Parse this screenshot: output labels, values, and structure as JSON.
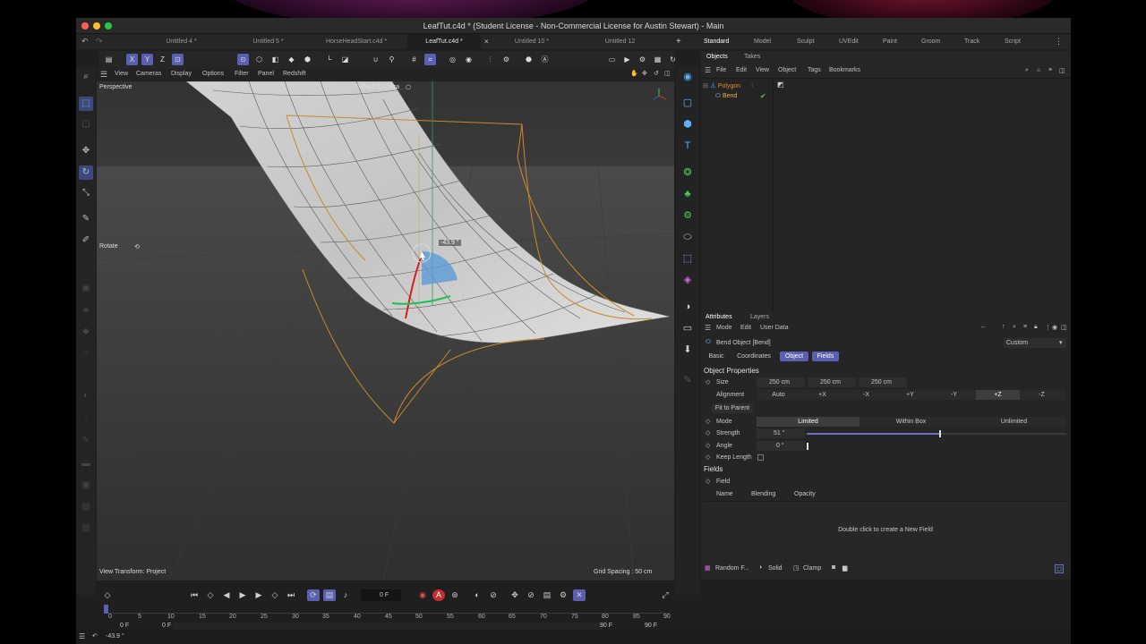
{
  "window": {
    "title": "LeafTut.c4d * (Student License - Non-Commercial License for Austin Stewart) - Main"
  },
  "doc_tabs": [
    {
      "label": "Untitled 4 *"
    },
    {
      "label": "Untitled 5 *"
    },
    {
      "label": "HorseHeadStart.c4d *"
    },
    {
      "label": "LeafTut.c4d *",
      "active": true
    },
    {
      "label": "Untitled 10 *"
    },
    {
      "label": "Untitled 12"
    }
  ],
  "new_tab_label": "+",
  "close_tab_label": "×",
  "layouts": [
    "Standard",
    "Model",
    "Sculpt",
    "UVEdit",
    "Paint",
    "Groom",
    "Track",
    "Script"
  ],
  "axis_buttons": {
    "x": "X",
    "y": "Y",
    "z": "Z"
  },
  "viewport_menu": [
    "View",
    "Cameras",
    "Display",
    "Options",
    "Filter",
    "Panel",
    "Redshift"
  ],
  "viewport": {
    "projection": "Perspective",
    "camera": "Default Camera",
    "tool_label": "Rotate",
    "angle_readout": "-43.9 °",
    "view_transform": "View Transform: Project",
    "grid_spacing": "Grid Spacing : 50 cm"
  },
  "objects_panel": {
    "tabs": [
      "Objects",
      "Takes"
    ],
    "menu": [
      "File",
      "Edit",
      "View",
      "Object",
      "Tags",
      "Bookmarks"
    ],
    "items": [
      {
        "name": "Polygon",
        "color": "#e08a2e"
      },
      {
        "name": "Bend",
        "color": "#f0b040"
      }
    ]
  },
  "attributes": {
    "tabs": [
      "Attributes",
      "Layers"
    ],
    "menu": [
      "Mode",
      "Edit",
      "User Data"
    ],
    "object_title": "Bend Object [Bend]",
    "preset": "Custom",
    "subtabs": [
      "Basic",
      "Coordinates",
      "Object",
      "Fields"
    ],
    "section_object": "Object Properties",
    "size_label": "Size",
    "size_values": [
      "250 cm",
      "250 cm",
      "250 cm"
    ],
    "alignment_label": "Alignment",
    "alignment_options": [
      "Auto",
      "+X",
      "-X",
      "+Y",
      "-Y",
      "+Z",
      "-Z"
    ],
    "alignment_selected": "+Z",
    "fit_to_parent": "Fit to Parent",
    "mode_label": "Mode",
    "mode_options": [
      "Limited",
      "Within Box",
      "Unlimited"
    ],
    "mode_selected": "Limited",
    "strength_label": "Strength",
    "strength_value": "51 °",
    "strength_fraction": 0.51,
    "angle_label": "Angle",
    "angle_value": "0 °",
    "keep_length_label": "Keep Length",
    "section_fields": "Fields",
    "field_label": "Field",
    "field_columns": [
      "Name",
      "Blending",
      "Opacity"
    ],
    "field_empty": "Double click to create a New Field"
  },
  "bottom_tools": [
    "Random F...",
    "Solid",
    "Clamp"
  ],
  "timeline": {
    "current_frame": "0 F",
    "ticks": [
      "0",
      "5",
      "10",
      "15",
      "20",
      "25",
      "30",
      "35",
      "40",
      "45",
      "50",
      "55",
      "60",
      "65",
      "70",
      "75",
      "80",
      "85",
      "90"
    ],
    "range_start": "0 F",
    "range_start2": "0 F",
    "range_end": "90 F",
    "range_end2": "90 F"
  },
  "status": {
    "readout": "-43.9 °"
  },
  "accent": "#5a5fb0"
}
